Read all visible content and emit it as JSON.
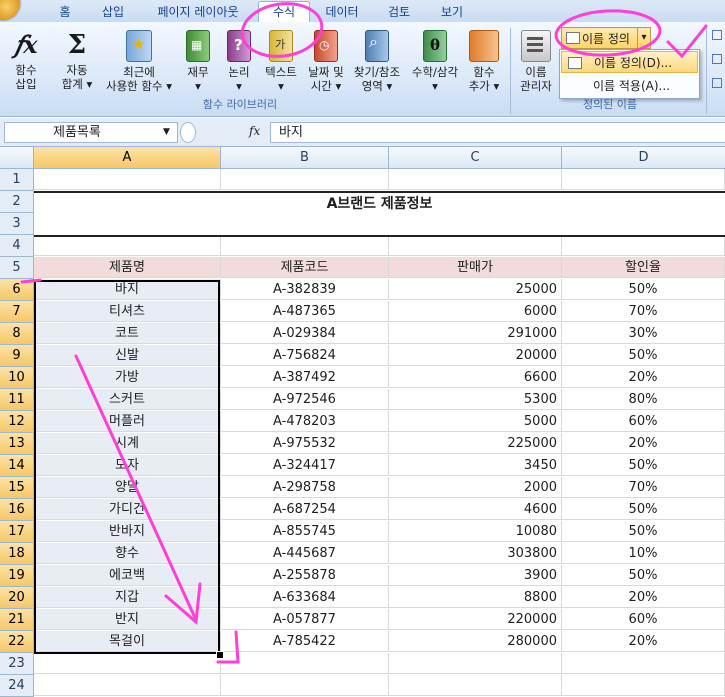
{
  "tabs": [
    "홈",
    "삽입",
    "페이지 레이아웃",
    "수식",
    "데이터",
    "검토",
    "보기"
  ],
  "ribbon": {
    "buttons": [
      {
        "l1": "함수",
        "l2": "삽입",
        "icon": "fx-icon"
      },
      {
        "l1": "자동",
        "l2": "합계 ▾",
        "icon": "sigma-icon"
      },
      {
        "l1": "최근에",
        "l2": "사용한 함수 ▾",
        "icon": "book-star-icon"
      },
      {
        "l1": "재무",
        "l2": "▾",
        "icon": "book-finance-icon"
      },
      {
        "l1": "논리",
        "l2": "▾",
        "icon": "book-logic-icon"
      },
      {
        "l1": "텍스트",
        "l2": "▾",
        "icon": "book-text-icon"
      },
      {
        "l1": "날짜 및",
        "l2": "시간 ▾",
        "icon": "book-date-icon"
      },
      {
        "l1": "찾기/참조",
        "l2": "영역 ▾",
        "icon": "book-lookup-icon"
      },
      {
        "l1": "수학/삼각",
        "l2": "▾",
        "icon": "book-math-icon"
      },
      {
        "l1": "함수",
        "l2": "추가 ▾",
        "icon": "book-more-icon"
      },
      {
        "l1": "이름",
        "l2": "관리자",
        "icon": "name-manager-icon"
      }
    ],
    "group_function_library": "함수 라이브러리",
    "group_defined_names": "정의된 이름",
    "name_define_split": "이름 정의",
    "name_define_arrow": "▾"
  },
  "dropdown": {
    "items": [
      "이름 정의(D)...",
      "이름 적용(A)..."
    ]
  },
  "formula_bar": {
    "name_box": "제품목록",
    "fx": "fx",
    "value": "바지"
  },
  "sheet": {
    "columns": [
      "A",
      "B",
      "C",
      "D"
    ],
    "title": "A브랜드 제품정보",
    "headers": [
      "제품명",
      "제품코드",
      "판매가",
      "할인율"
    ],
    "rows": [
      [
        "바지",
        "A-382839",
        "25000",
        "50%"
      ],
      [
        "티셔츠",
        "A-487365",
        "6000",
        "70%"
      ],
      [
        "코트",
        "A-029384",
        "291000",
        "30%"
      ],
      [
        "신발",
        "A-756824",
        "20000",
        "50%"
      ],
      [
        "가방",
        "A-387492",
        "6600",
        "20%"
      ],
      [
        "스커트",
        "A-972546",
        "5300",
        "80%"
      ],
      [
        "머플러",
        "A-478203",
        "5000",
        "60%"
      ],
      [
        "시계",
        "A-975532",
        "225000",
        "20%"
      ],
      [
        "모자",
        "A-324417",
        "3450",
        "50%"
      ],
      [
        "양말",
        "A-298758",
        "2000",
        "70%"
      ],
      [
        "가디건",
        "A-687254",
        "4600",
        "50%"
      ],
      [
        "반바지",
        "A-855745",
        "10080",
        "50%"
      ],
      [
        "향수",
        "A-445687",
        "303800",
        "10%"
      ],
      [
        "에코백",
        "A-255878",
        "3900",
        "50%"
      ],
      [
        "지갑",
        "A-633684",
        "8800",
        "20%"
      ],
      [
        "반지",
        "A-057877",
        "220000",
        "60%"
      ],
      [
        "목걸이",
        "A-785422",
        "280000",
        "20%"
      ]
    ],
    "row_numbers": [
      "1",
      "2",
      "3",
      "4",
      "5",
      "6",
      "7",
      "8",
      "9",
      "10",
      "11",
      "12",
      "13",
      "14",
      "15",
      "16",
      "17",
      "18",
      "19",
      "20",
      "21",
      "22",
      "23",
      "24"
    ]
  },
  "colors": {
    "header_fill": "#f2dcdb",
    "selection_fill": "#e8ecf5",
    "annotation_pink": "#ff3fd6"
  }
}
